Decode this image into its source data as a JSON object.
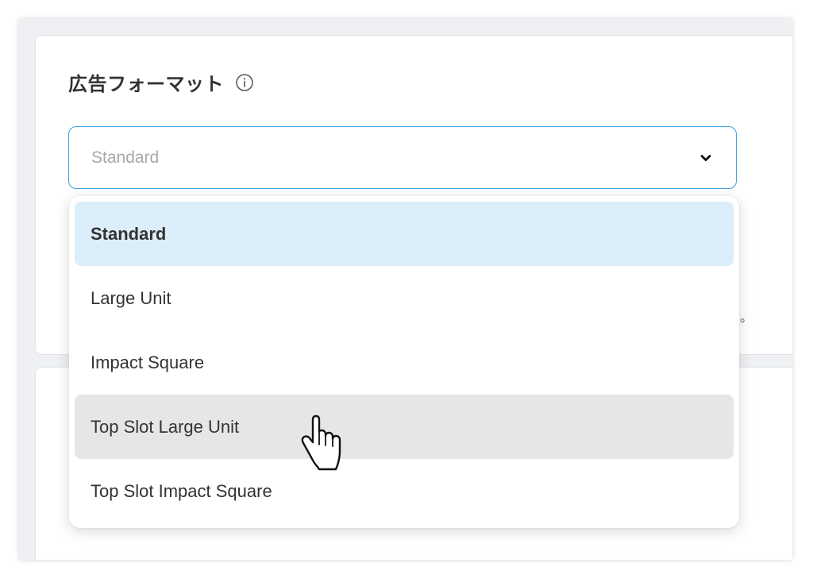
{
  "section": {
    "title": "広告フォーマット"
  },
  "select": {
    "value": "Standard"
  },
  "dropdown": {
    "options": [
      {
        "label": "Standard",
        "state": "selected"
      },
      {
        "label": "Large Unit",
        "state": "normal"
      },
      {
        "label": "Impact Square",
        "state": "normal"
      },
      {
        "label": "Top Slot Large Unit",
        "state": "hovered"
      },
      {
        "label": "Top Slot Impact Square",
        "state": "normal"
      }
    ]
  },
  "background": {
    "stray_mark": "。"
  },
  "colors": {
    "focus_border": "#3aa1dc",
    "selected_bg": "#dbeefa",
    "hover_bg": "#e6e6e6",
    "page_bg": "#eef0f3"
  },
  "icons": {
    "info": "info-icon",
    "chevron": "chevron-down-icon",
    "cursor": "hand-pointer-cursor-icon"
  }
}
